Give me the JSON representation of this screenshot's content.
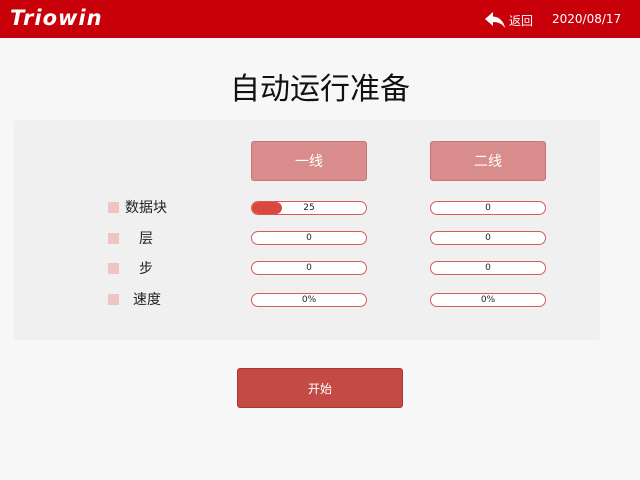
{
  "header": {
    "logo_text": "Triowin",
    "back_label": "返回",
    "date": "2020/08/17"
  },
  "page_title": "自动运行准备",
  "columns": [
    {
      "label": "一线"
    },
    {
      "label": "二线"
    }
  ],
  "rows": [
    {
      "label": "数据块",
      "line1": "25",
      "line2": "0"
    },
    {
      "label": "层",
      "line1": "0",
      "line2": "0"
    },
    {
      "label": "步",
      "line1": "0",
      "line2": "0"
    },
    {
      "label": "速度",
      "line1": "0%",
      "line2": "0%"
    }
  ],
  "progress": {
    "line1_datablock_fraction": 0.26
  },
  "start_label": "开始",
  "colors": {
    "header_bg": "#c8000a",
    "column_button": "#d98c8c",
    "start_button": "#c44a46",
    "field_border": "#d55a5a",
    "progress_fill": "#d9473f"
  },
  "icons": {
    "back": "back-arrow-icon"
  }
}
